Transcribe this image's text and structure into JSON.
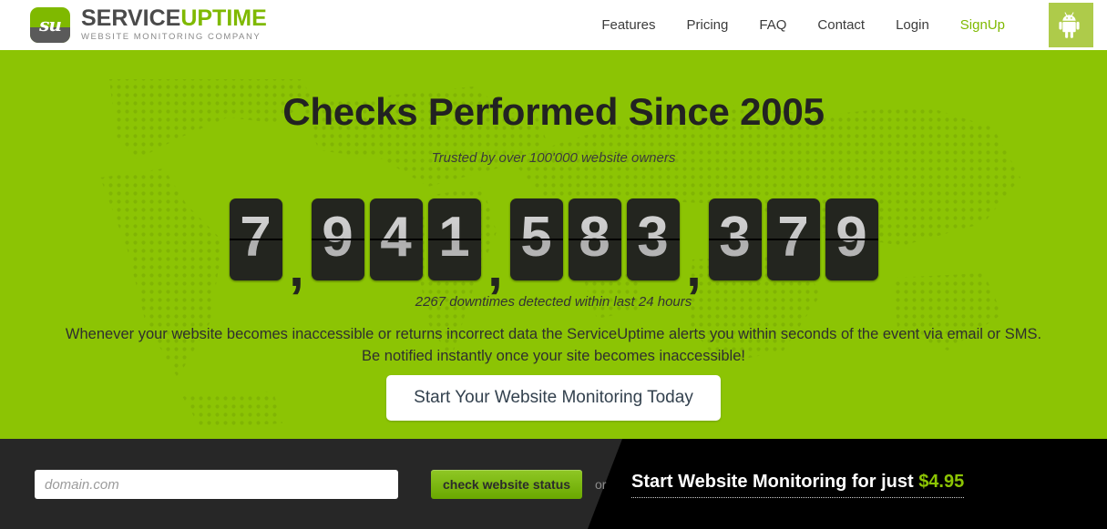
{
  "header": {
    "logo": {
      "mark_glyph": "su",
      "name_primary": "SERVICE",
      "name_accent": "UPTIME",
      "tagline": "WEBSITE MONITORING COMPANY"
    },
    "nav": [
      {
        "label": "Features",
        "accent": false
      },
      {
        "label": "Pricing",
        "accent": false
      },
      {
        "label": "FAQ",
        "accent": false
      },
      {
        "label": "Contact",
        "accent": false
      },
      {
        "label": "Login",
        "accent": false
      },
      {
        "label": "SignUp",
        "accent": true
      }
    ],
    "android_button": {
      "icon": "android-icon",
      "label": ""
    }
  },
  "hero": {
    "title": "Checks Performed Since 2005",
    "subtitle": "Trusted by over 100'000 website owners",
    "counter": {
      "value": "7,941,583,379",
      "digits": [
        "7",
        ",",
        "9",
        "4",
        "1",
        ",",
        "5",
        "8",
        "3",
        ",",
        "3",
        "7",
        "9"
      ]
    },
    "downtimes": "2267 downtimes detected within last 24 hours",
    "description_line1": "Whenever your website becomes inaccessible or returns incorrect data the ServiceUptime alerts you within seconds of the event via email or SMS.",
    "description_line2": "Be notified instantly once your site becomes inaccessible!",
    "cta_label": "Start Your Website Monitoring Today"
  },
  "bottom_bar": {
    "domain_placeholder": "domain.com",
    "domain_value": "",
    "check_label": "check website status",
    "or_label": "or",
    "offer_text": "Start Website Monitoring for just ",
    "offer_price": "$4.95"
  },
  "colors": {
    "hero_green": "#8cc404",
    "accent_green": "#7fb900",
    "android_green": "#aecb4a",
    "bar_dark": "#272727",
    "bar_black": "#000000",
    "digit_tile": "#23251f"
  }
}
